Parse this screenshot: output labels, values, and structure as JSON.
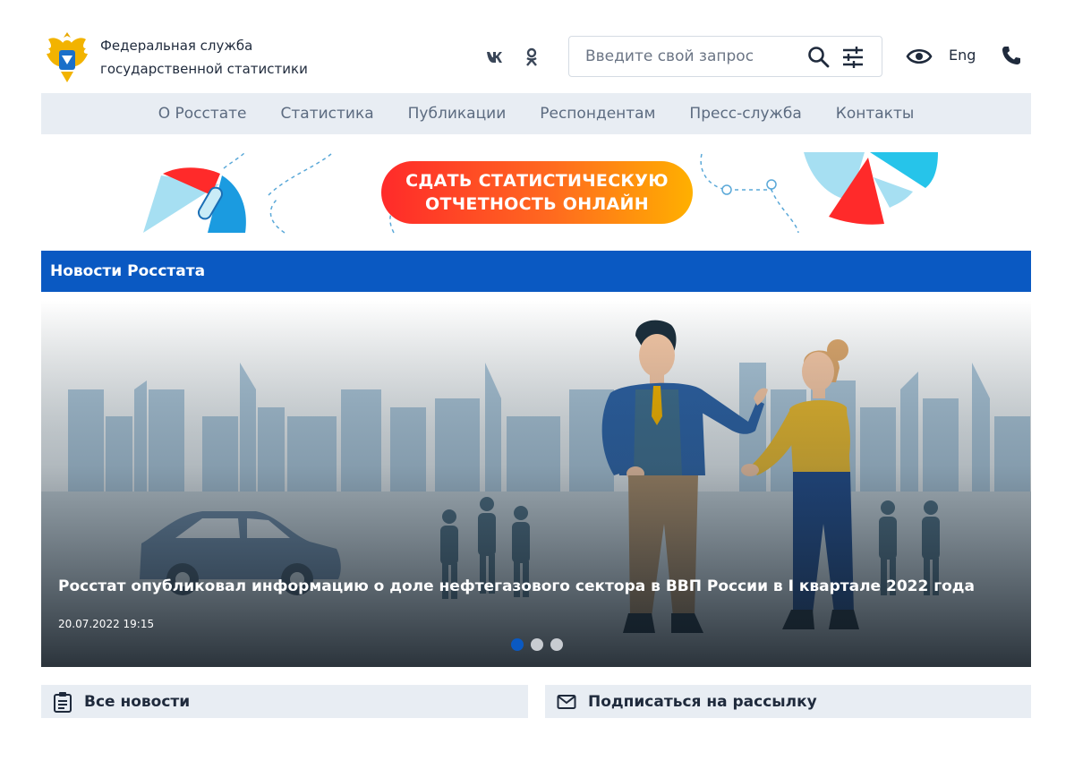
{
  "header": {
    "org_name_line1": "Федеральная служба",
    "org_name_line2": "государственной статистики",
    "logo_icon": "coat-of-arms-icon",
    "search_placeholder": "Введите свой запрос",
    "lang_label": "Eng",
    "social": [
      "vk-icon",
      "ok-icon"
    ]
  },
  "nav": {
    "items": [
      "О Росстате",
      "Статистика",
      "Публикации",
      "Респондентам",
      "Пресс-служба",
      "Контакты"
    ]
  },
  "banner": {
    "line1": "СДАТЬ СТАТИСТИЧЕСКУЮ",
    "line2": "ОТЧЕТНОСТЬ ОНЛАЙН"
  },
  "news": {
    "section_title": "Новости Росстата",
    "slide_title": "Росстат опубликовал информацию о доле нефтегазового сектора в ВВП России в I квартале 2022 года",
    "slide_date": "20.07.2022 19:15",
    "slide_count": 3,
    "active_slide": 1
  },
  "bottom": {
    "all_news": "Все новости",
    "subscribe": "Подписаться на рассылку"
  },
  "colors": {
    "brand_blue": "#0a59c2",
    "nav_bg": "#e8edf3",
    "cta_start": "#ff2a2a",
    "cta_end": "#ffb000"
  }
}
